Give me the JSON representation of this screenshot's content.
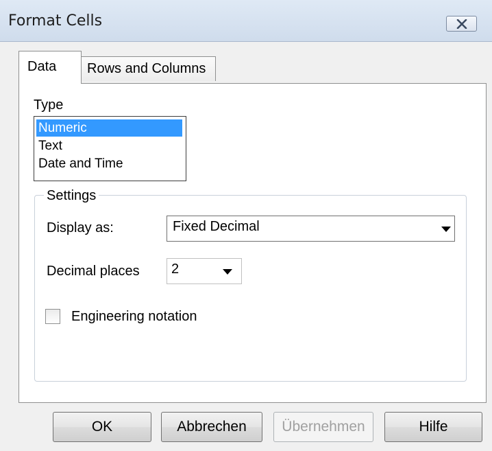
{
  "window": {
    "title": "Format Cells",
    "close_icon": "close-icon"
  },
  "tabs": [
    {
      "label": "Data",
      "active": true
    },
    {
      "label": "Rows and Columns",
      "active": false
    }
  ],
  "type": {
    "label": "Type",
    "options": [
      "Numeric",
      "Text",
      "Date and Time"
    ],
    "selected": "Numeric"
  },
  "settings": {
    "legend": "Settings",
    "display_as_label": "Display as:",
    "display_as_value": "Fixed Decimal",
    "decimal_places_label": "Decimal places",
    "decimal_places_value": "2",
    "engineering_notation_label": "Engineering notation",
    "engineering_notation_checked": false
  },
  "buttons": {
    "ok": "OK",
    "cancel": "Abbrechen",
    "apply": "Übernehmen",
    "help": "Hilfe"
  },
  "colors": {
    "selection": "#3399ff",
    "dialog_bg": "#f0f0f0"
  }
}
